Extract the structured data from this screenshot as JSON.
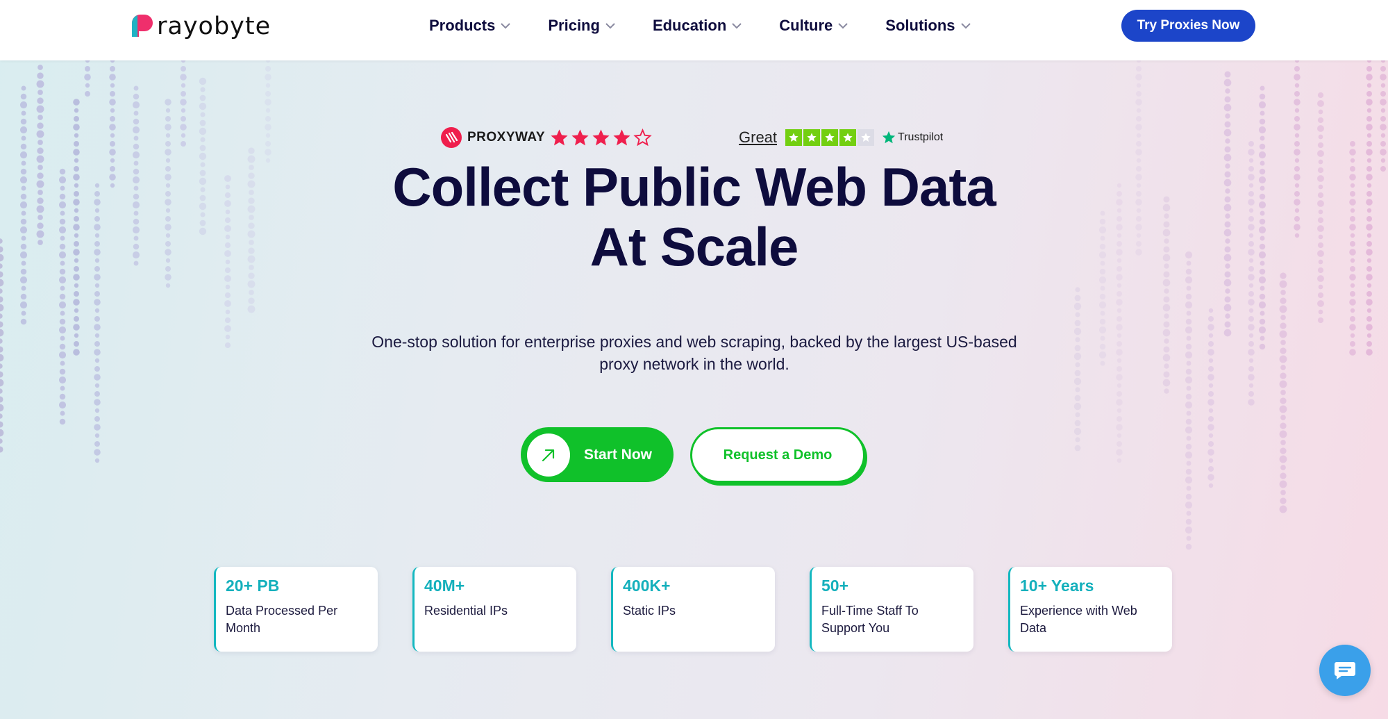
{
  "brand": {
    "name": "rayobyte"
  },
  "nav": {
    "items": [
      {
        "label": "Products"
      },
      {
        "label": "Pricing"
      },
      {
        "label": "Education"
      },
      {
        "label": "Culture"
      },
      {
        "label": "Solutions"
      }
    ],
    "cta_label": "Try Proxies Now"
  },
  "ratings": {
    "proxyway": {
      "name": "PROXYWAY",
      "stars": 4,
      "max_stars": 5
    },
    "trustpilot": {
      "rating_word": "Great",
      "name": "Trustpilot",
      "stars": 4,
      "max_stars": 5
    }
  },
  "hero": {
    "title_line1": "Collect Public Web Data",
    "title_line2": "At Scale",
    "subtitle_line1": "One-stop solution for enterprise proxies and web scraping, backed by the largest US-based",
    "subtitle_line2": "proxy network in the world.",
    "start_label": "Start Now",
    "demo_label": "Request a Demo"
  },
  "stats": [
    {
      "value": "20+ PB",
      "label": "Data Processed Per Month"
    },
    {
      "value": "40M+",
      "label": "Residential IPs"
    },
    {
      "value": "400K+",
      "label": "Static IPs"
    },
    {
      "value": "50+",
      "label": "Full-Time Staff To Support You"
    },
    {
      "value": "10+ Years",
      "label": "Experience with Web Data"
    }
  ],
  "colors": {
    "primary_blue": "#1c45c9",
    "green": "#10c12a",
    "teal": "#14b0bc",
    "navy": "#0e0c3d",
    "proxyway_red": "#ef1f4d",
    "trustpilot_green": "#73cf11",
    "chat_blue": "#3aa0ea"
  },
  "icons": {
    "logo": "rayobyte-logo-icon",
    "nav_chevron": "chevron-down-icon",
    "start_arrow": "arrow-up-right-icon",
    "chat": "chat-bubble-icon"
  }
}
